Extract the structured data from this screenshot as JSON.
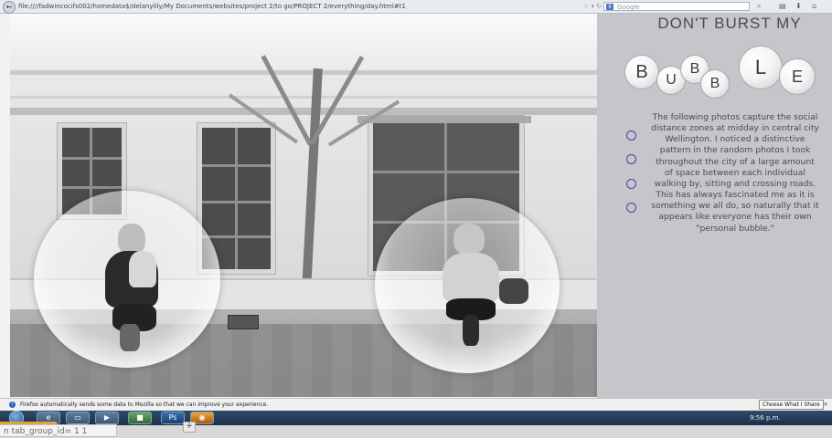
{
  "browser": {
    "url": "file:////fadwincocifs002/homedata$/delanylily/My Documents/websites/project 2/to go/PROJECT 2/everything/day.html#t1",
    "search_placeholder": "Google",
    "back_symbol": "←"
  },
  "page": {
    "title": "DON'T BURST MY",
    "bubble_letters": [
      "B",
      "U",
      "B",
      "B",
      "L",
      "E"
    ],
    "description": "The following photos capture the social distance zones at midday in central city Wellington. I noticed a distinctive pattern in the random photos I took throughout the city of a large amount of space between each individual walking by, sitting and crossing roads. This has always fascinated me as it is something we all do, so naturally that it appears like everyone has their own \"personal bubble.\"",
    "nav_dots": 4,
    "accent_color": "#4a43a0"
  },
  "notification": {
    "message": "Firefox automatically sends some data to Mozilla so that we can improve your experience.",
    "button": "Choose What I Share",
    "close": "×"
  },
  "taskbar": {
    "clock": "9:56 p.m.",
    "plus": "+"
  },
  "tab_group": "n tab_group_id= 1 1"
}
